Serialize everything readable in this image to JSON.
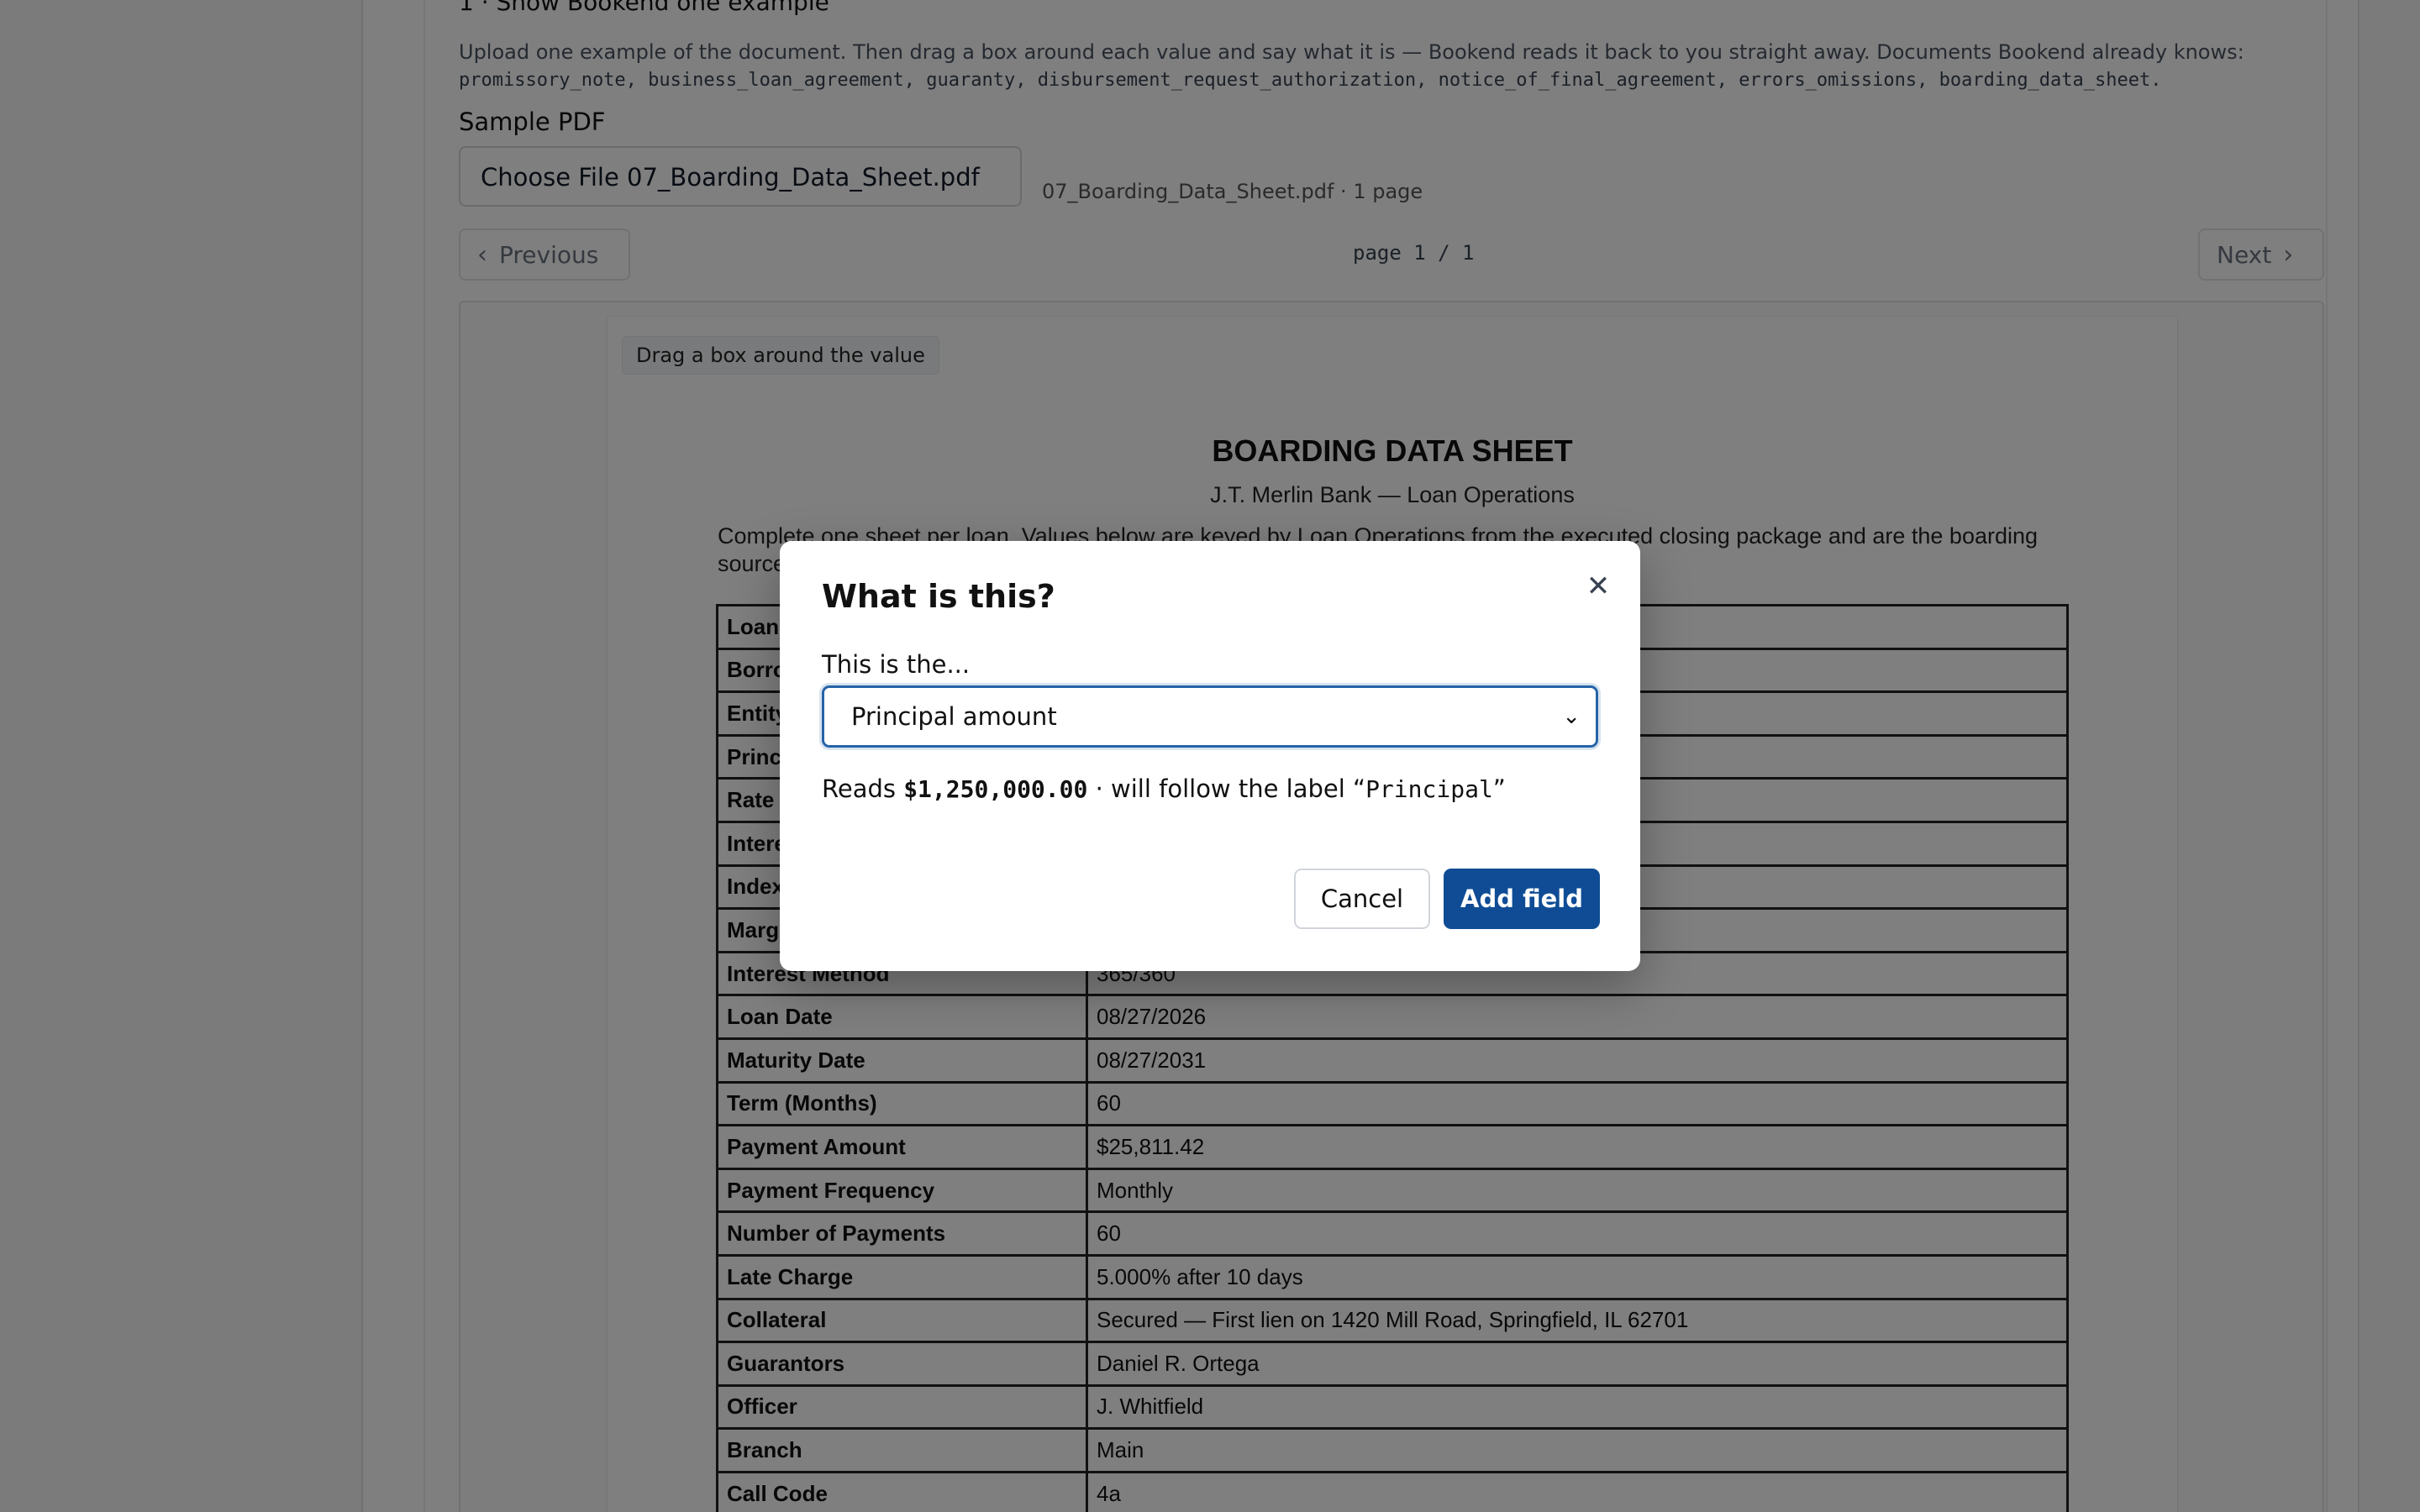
{
  "section": {
    "title": "1 · Show Bookend one example",
    "help": "Upload one example of the document. Then drag a box around each value and say what it is — Bookend reads it back to you straight away. Documents Bookend already knows:",
    "known_docs": "promissory_note, business_loan_agreement, guaranty, disbursement_request_authorization, notice_of_final_agreement, errors_omissions, boarding_data_sheet."
  },
  "upload": {
    "label": "Sample PDF",
    "button": "Choose File",
    "filename": "07_Boarding_Data_Sheet.pdf",
    "meta": "07_Boarding_Data_Sheet.pdf · 1 page"
  },
  "pager": {
    "prev": "Previous",
    "next": "Next",
    "indicator": "page 1 / 1"
  },
  "viewer": {
    "hint": "Drag a box around the value"
  },
  "document": {
    "title": "BOARDING DATA SHEET",
    "subtitle": "J.T. Merlin Bank — Loan Operations",
    "intro": "Complete one sheet per loan. Values below are keyed by Loan Operations from the executed closing package and are the boarding source",
    "rows": [
      {
        "k": "Loan",
        "v": ""
      },
      {
        "k": "Borro",
        "v": ""
      },
      {
        "k": "Entity",
        "v": ""
      },
      {
        "k": "Princ",
        "v": ""
      },
      {
        "k": "Rate",
        "v": ""
      },
      {
        "k": "Intere",
        "v": ""
      },
      {
        "k": "Index",
        "v": ""
      },
      {
        "k": "Marg",
        "v": ""
      },
      {
        "k": "Interest Method",
        "v": "365/360"
      },
      {
        "k": "Loan Date",
        "v": "08/27/2026"
      },
      {
        "k": "Maturity Date",
        "v": "08/27/2031"
      },
      {
        "k": "Term (Months)",
        "v": "60"
      },
      {
        "k": "Payment Amount",
        "v": "$25,811.42"
      },
      {
        "k": "Payment Frequency",
        "v": "Monthly"
      },
      {
        "k": "Number of Payments",
        "v": "60"
      },
      {
        "k": "Late Charge",
        "v": "5.000% after 10 days"
      },
      {
        "k": "Collateral",
        "v": "Secured — First lien on 1420 Mill Road, Springfield, IL 62701"
      },
      {
        "k": "Guarantors",
        "v": "Daniel R. Ortega"
      },
      {
        "k": "Officer",
        "v": "J. Whitfield"
      },
      {
        "k": "Branch",
        "v": "Main"
      },
      {
        "k": "Call Code",
        "v": "4a"
      }
    ]
  },
  "modal": {
    "title": "What is this?",
    "field_label": "This is the...",
    "selected": "Principal amount",
    "reads_prefix": "Reads",
    "reads_value": "$1,250,000.00",
    "reads_middle": "· will follow the label",
    "label_open": "“",
    "label_value": "Principal",
    "label_close": "”",
    "cancel": "Cancel",
    "add": "Add field"
  },
  "icons": {
    "close": "close-icon",
    "chevron_left": "chevron-left-icon",
    "chevron_right": "chevron-right-icon",
    "chevron_down": "chevron-down-icon"
  },
  "colors": {
    "primary": "#0f4c95",
    "focus": "#2563a8"
  }
}
